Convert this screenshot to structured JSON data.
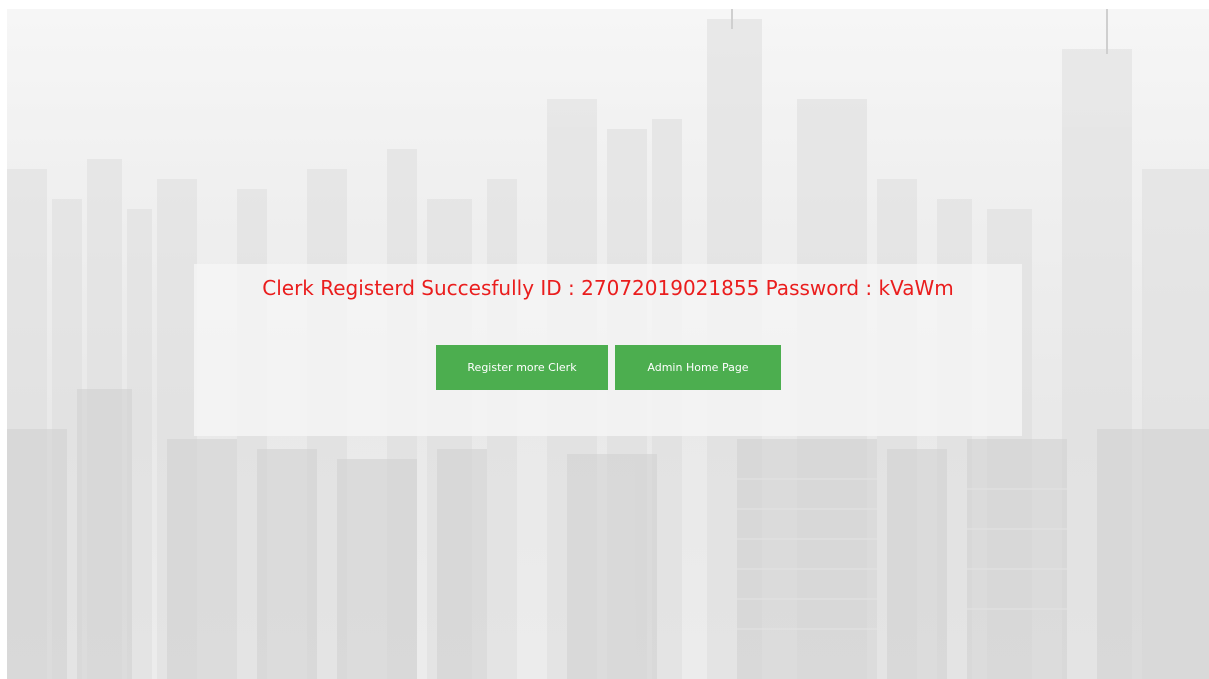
{
  "background": {
    "description_icon": "city-skyline-photo"
  },
  "result": {
    "message": "Clerk Registerd Succesfully ID : 27072019021855 Password : kVaWm",
    "message_color": "#ea1d1d"
  },
  "actions": {
    "register_more_label": "Register more Clerk",
    "admin_home_label": "Admin Home Page",
    "button_color": "#4cae4f"
  }
}
